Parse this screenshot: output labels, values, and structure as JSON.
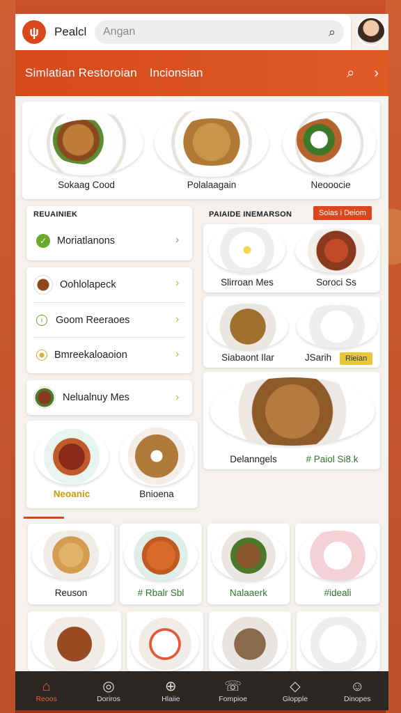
{
  "topbar": {
    "brand": "Pealcl",
    "search_placeholder": "Angan"
  },
  "header": {
    "title": "Simlatian Restoroian",
    "subtitle": "Incionsian"
  },
  "featured": [
    {
      "label": "Sokaag Cood"
    },
    {
      "label": "Polalaagain"
    },
    {
      "label": "Neooocie"
    }
  ],
  "left_panel": {
    "section_title": "REUAINIEK",
    "item1": "Moriatlanons",
    "group": [
      "Oohlolapeck",
      "Goom Reeraoes",
      "Bmreekaloaoion"
    ],
    "item_last": "Nelualnuy Mes",
    "pair": [
      "Neoanic",
      "Bnioena"
    ]
  },
  "right_panel": {
    "section_title": "PAIAIDE INEMARSON",
    "badge": "Soias i Deiom",
    "items": [
      "Slirroan Mes",
      "Soroci Ss",
      "Siabaont Ilar",
      "JSarih"
    ],
    "tag": "Rieian",
    "big_left": "Delanngels",
    "big_right": "# Paiol Si8.k"
  },
  "bottom_row": [
    "Reuson",
    "# Rbalr Sbl",
    "Nalaaerk",
    "#ideali"
  ],
  "nav": [
    {
      "label": "Reoos",
      "icon": "home-icon"
    },
    {
      "label": "Doriros",
      "icon": "compass-icon"
    },
    {
      "label": "Hlaiie",
      "icon": "globe-icon"
    },
    {
      "label": "Fompioe",
      "icon": "chat-icon"
    },
    {
      "label": "Glopple",
      "icon": "shield-icon"
    },
    {
      "label": "Dinopes",
      "icon": "user-icon"
    }
  ],
  "colors": {
    "accent": "#d9481d",
    "nav_bg": "#2a2724",
    "panel": "#f4f1ee"
  }
}
